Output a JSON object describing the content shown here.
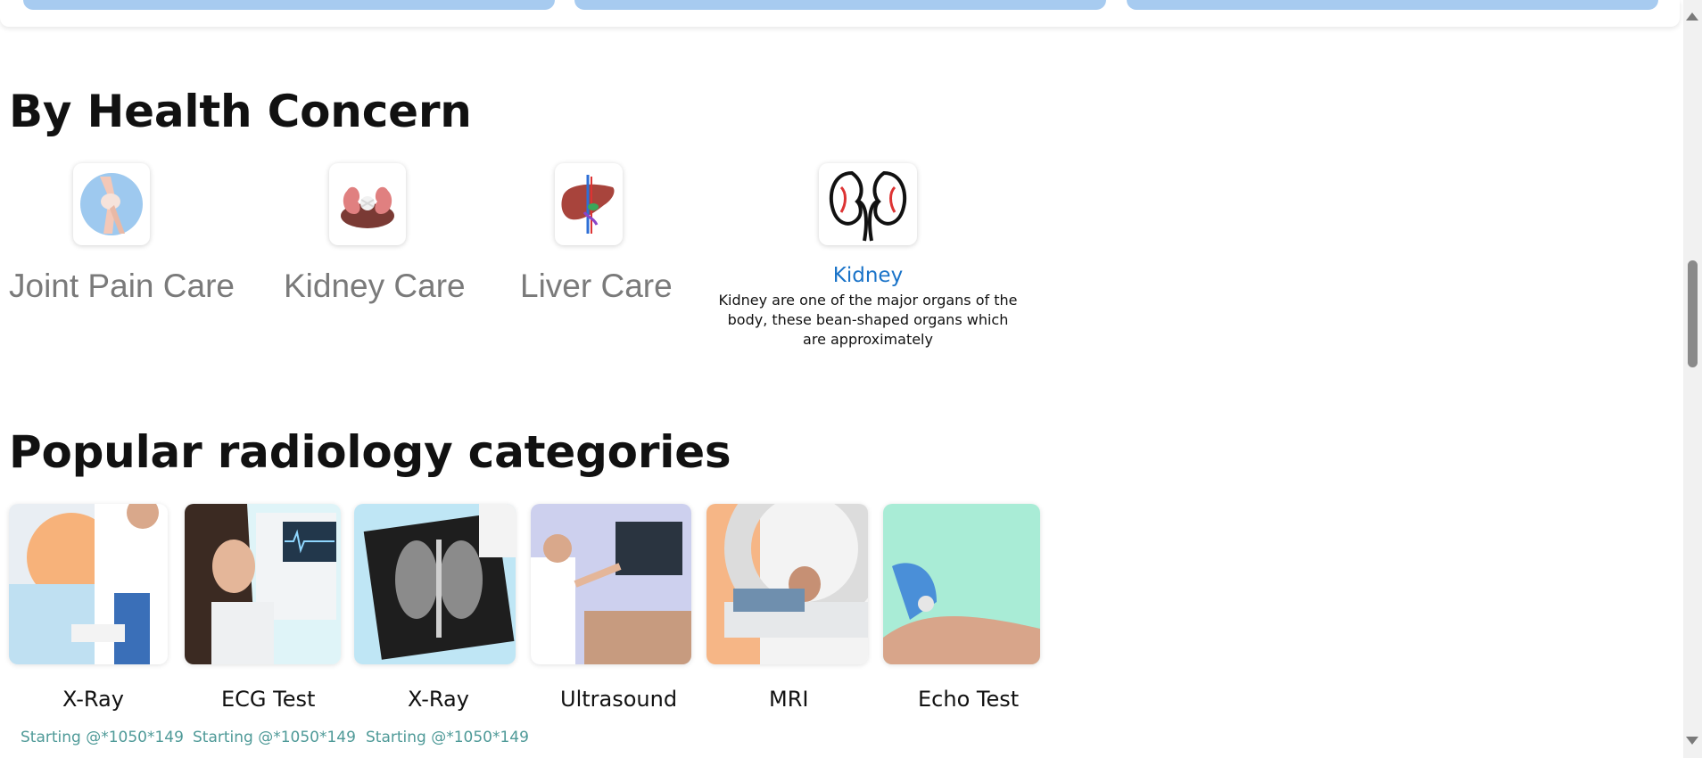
{
  "health_concern": {
    "title": "By Health Concern",
    "items": [
      {
        "label": "Joint Pain Care",
        "icon": "knee-joint-icon"
      },
      {
        "label": "Kidney Care",
        "icon": "kidney-organ-icon"
      },
      {
        "label": "Liver Care",
        "icon": "liver-organ-icon"
      }
    ],
    "kidney": {
      "title": "Kidney",
      "description": "Kidney are one of the major organs of the body, these bean-shaped organs which are approximately",
      "icon": "kidney-outline-icon"
    }
  },
  "radiology": {
    "title": "Popular radiology categories",
    "items": [
      {
        "label": "X-Ray",
        "price": "Starting @*1050*149"
      },
      {
        "label": "ECG Test",
        "price": "Starting @*1050*149"
      },
      {
        "label": "X-Ray",
        "price": "Starting @*1050*149"
      },
      {
        "label": "Ultrasound",
        "price": ""
      },
      {
        "label": "MRI",
        "price": ""
      },
      {
        "label": "Echo Test",
        "price": ""
      }
    ]
  },
  "colors": {
    "accent_blue": "#1a73c8",
    "price_teal": "#4f9a98",
    "pill_blue": "#a7cbf0"
  }
}
